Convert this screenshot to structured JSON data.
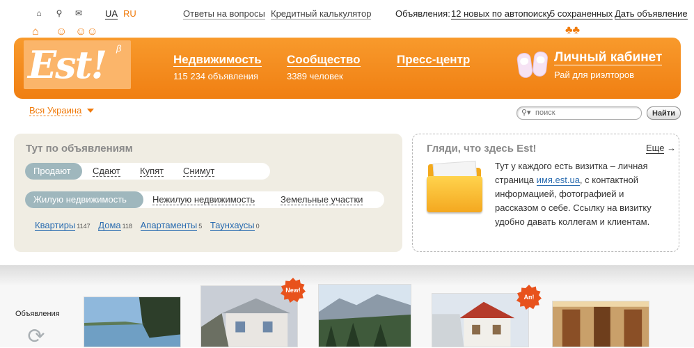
{
  "topbar": {
    "icons": [
      "home-icon",
      "search-icon",
      "mail-icon"
    ],
    "lang_ua": "UA",
    "lang_ru": "RU",
    "link_answers": "Ответы на вопросы",
    "link_calculator": "Кредитный калькулятор",
    "ads_label": "Объявления:",
    "ads_new": "12 новых по автопоиску",
    "ads_saved": "5 сохраненных",
    "ads_post": "Дать объявление"
  },
  "header": {
    "logo_text": "Est!",
    "logo_beta": "β",
    "nav": [
      {
        "title": "Недвижимость",
        "sub": "115 234 объявления"
      },
      {
        "title": "Сообщество",
        "sub": "3389 человек"
      },
      {
        "title": "Пресс-центр",
        "sub": ""
      },
      {
        "title": "Личный кабинет",
        "sub": "Рай для риэлторов"
      }
    ],
    "accent_color": "#f68b1f"
  },
  "region": {
    "label": "Вся Украина"
  },
  "search": {
    "placeholder": "поиск",
    "button": "Найти"
  },
  "listings": {
    "title": "Тут по объявлениям",
    "deal_tabs": [
      {
        "label": "Продают",
        "active": true
      },
      {
        "label": "Сдают",
        "active": false
      },
      {
        "label": "Купят",
        "active": false
      },
      {
        "label": "Снимут",
        "active": false
      }
    ],
    "type_tabs": [
      {
        "label": "Жилую недвижимость",
        "active": true
      },
      {
        "label": "Нежилую недвижимость",
        "active": false
      },
      {
        "label": "Земельные участки",
        "active": false
      }
    ],
    "categories": [
      {
        "label": "Квартиры",
        "count": "1147"
      },
      {
        "label": "Дома",
        "count": "118"
      },
      {
        "label": "Апартаменты",
        "count": "5"
      },
      {
        "label": "Таунхаусы",
        "count": "0"
      }
    ]
  },
  "info": {
    "title": "Гляди, что здесь Est!",
    "more": "Еще",
    "more_arrow": "→",
    "text_1": "Тут у каждого есть визитка – личная страница ",
    "link": "имя.est.ua",
    "text_2": ", с контактной информацией, фотографией и рассказом о себе. Ссылку на визитку удобно давать коллегам и клиентам."
  },
  "strip": {
    "label": "Объявления",
    "badge_new": "New!",
    "badge_an": "Ап!"
  }
}
